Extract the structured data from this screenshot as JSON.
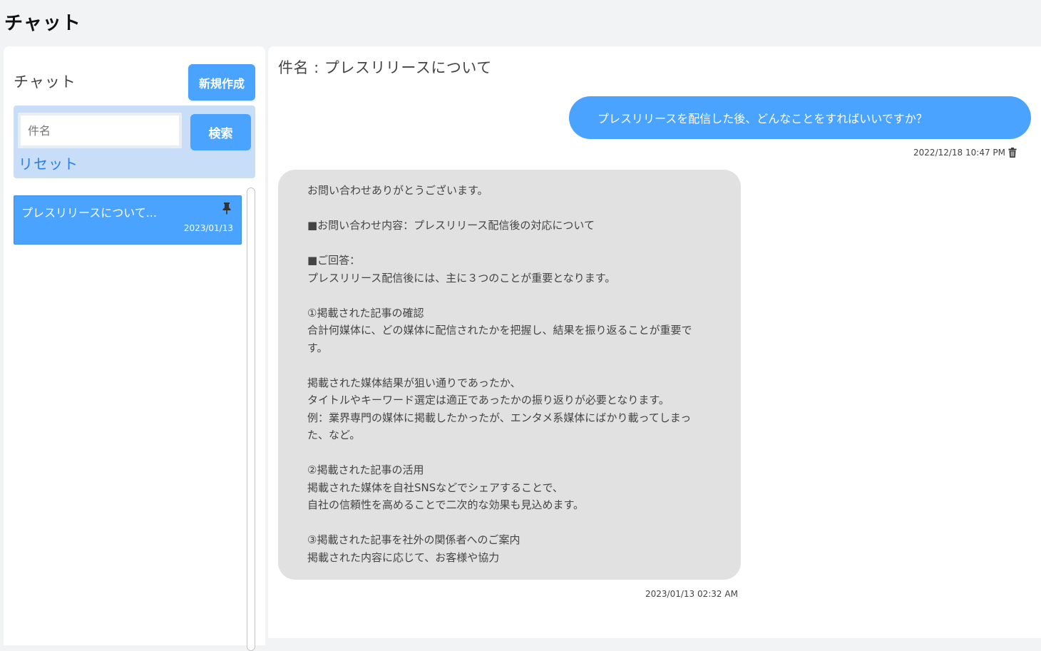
{
  "page": {
    "title": "チャット"
  },
  "sidebar": {
    "title": "チャット",
    "new_button": "新規作成",
    "search": {
      "placeholder": "件名",
      "value": "",
      "button": "検索",
      "reset": "リセット"
    },
    "chats": [
      {
        "title": "プレスリリースについて...",
        "date": "2023/01/13",
        "pinned": true,
        "selected": true
      }
    ]
  },
  "main": {
    "subject": "件名 : プレスリリースについて",
    "messages": [
      {
        "role": "user",
        "text": "プレスリリースを配信した後、どんなことをすればいいですか？",
        "time": "2022/12/18 10:47 PM"
      },
      {
        "role": "assistant",
        "text": "お問い合わせありがとうございます。\n\n■お問い合わせ内容：プレスリリース配信後の対応について\n\n■ご回答：\nプレスリリース配信後には、主に３つのことが重要となります。\n\n①掲載された記事の確認\n合計何媒体に、どの媒体に配信されたかを把握し、結果を振り返ることが重要で\nす。\n\n掲載された媒体結果が狙い通りであったか、\nタイトルやキーワード選定は適正であったかの振り返りが必要となります。\n例：業界専門の媒体に掲載したかったが、エンタメ系媒体にばかり載ってしまっ\nた、など。\n\n②掲載された記事の活用\n掲載された媒体を自社SNSなどでシェアすることで、\n自社の信頼性を高めることで二次的な効果も見込めます。\n\n③掲載された記事を社外の関係者へのご案内\n掲載された内容に応じて、お客様や協力",
        "time": "2023/01/13 02:32 AM"
      }
    ]
  },
  "icons": {
    "pin": "pin-icon",
    "trash": "trash-icon"
  },
  "colors": {
    "accent": "#4aa3ff",
    "search_panel": "#c8ddf7",
    "assistant_bubble": "#e1e1e1",
    "link": "#2b7de9"
  }
}
